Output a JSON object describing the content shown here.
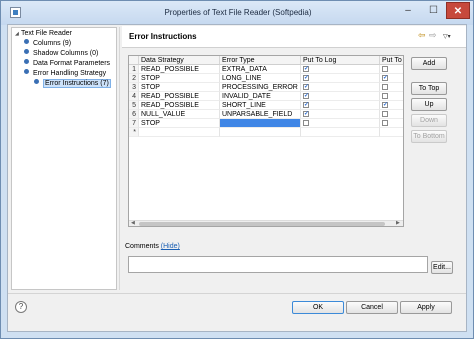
{
  "window": {
    "title": "Properties of Text File Reader (Softpedia)",
    "minimize": "–",
    "maximize": "☐",
    "close": "✕"
  },
  "tree": {
    "items": [
      {
        "label": "Text File Reader",
        "depth": 0,
        "expanded": true
      },
      {
        "label": "Columns (9)",
        "depth": 1
      },
      {
        "label": "Shadow Columns (0)",
        "depth": 1
      },
      {
        "label": "Data Format Parameters",
        "depth": 1
      },
      {
        "label": "Error Handling Strategy",
        "depth": 1,
        "expanded": true
      },
      {
        "label": "Error Instructions (7)",
        "depth": 2,
        "selected": true
      }
    ]
  },
  "header": {
    "title": "Error Instructions",
    "back_icon": "⇦",
    "forward_icon": "⇨",
    "menu_icon": "▽▾"
  },
  "table": {
    "columns": [
      "",
      "Data Strategy",
      "Error Type",
      "Put To Log",
      "Put To"
    ],
    "rows": [
      {
        "n": "1",
        "strategy": "READ_POSSIBLE",
        "type": "EXTRA_DATA",
        "log": true,
        "put": false
      },
      {
        "n": "2",
        "strategy": "STOP",
        "type": "LONG_LINE",
        "log": true,
        "put": true
      },
      {
        "n": "3",
        "strategy": "STOP",
        "type": "PROCESSING_ERROR",
        "log": true,
        "put": false
      },
      {
        "n": "4",
        "strategy": "READ_POSSIBLE",
        "type": "INVALID_DATE",
        "log": true,
        "put": false
      },
      {
        "n": "5",
        "strategy": "READ_POSSIBLE",
        "type": "SHORT_LINE",
        "log": true,
        "put": true
      },
      {
        "n": "6",
        "strategy": "NULL_VALUE",
        "type": "UNPARSABLE_FIELD",
        "log": true,
        "put": false
      },
      {
        "n": "7",
        "strategy": "STOP",
        "type": "",
        "log": false,
        "put": false,
        "editing": true
      },
      {
        "n": "*",
        "strategy": "",
        "type": "",
        "log": null,
        "put": null
      }
    ]
  },
  "side_buttons": {
    "add": "Add",
    "to_top": "To Top",
    "up": "Up",
    "down": "Down",
    "to_bottom": "To Bottom"
  },
  "comments": {
    "label": "Comments",
    "hide_link": "(Hide)",
    "value": "",
    "edit_button": "Edit..."
  },
  "footer": {
    "help_icon": "?",
    "ok": "OK",
    "cancel": "Cancel",
    "apply": "Apply"
  },
  "colors": {
    "selection": "#3f86e6",
    "link": "#1a5fb4",
    "close_button": "#c7493c"
  }
}
